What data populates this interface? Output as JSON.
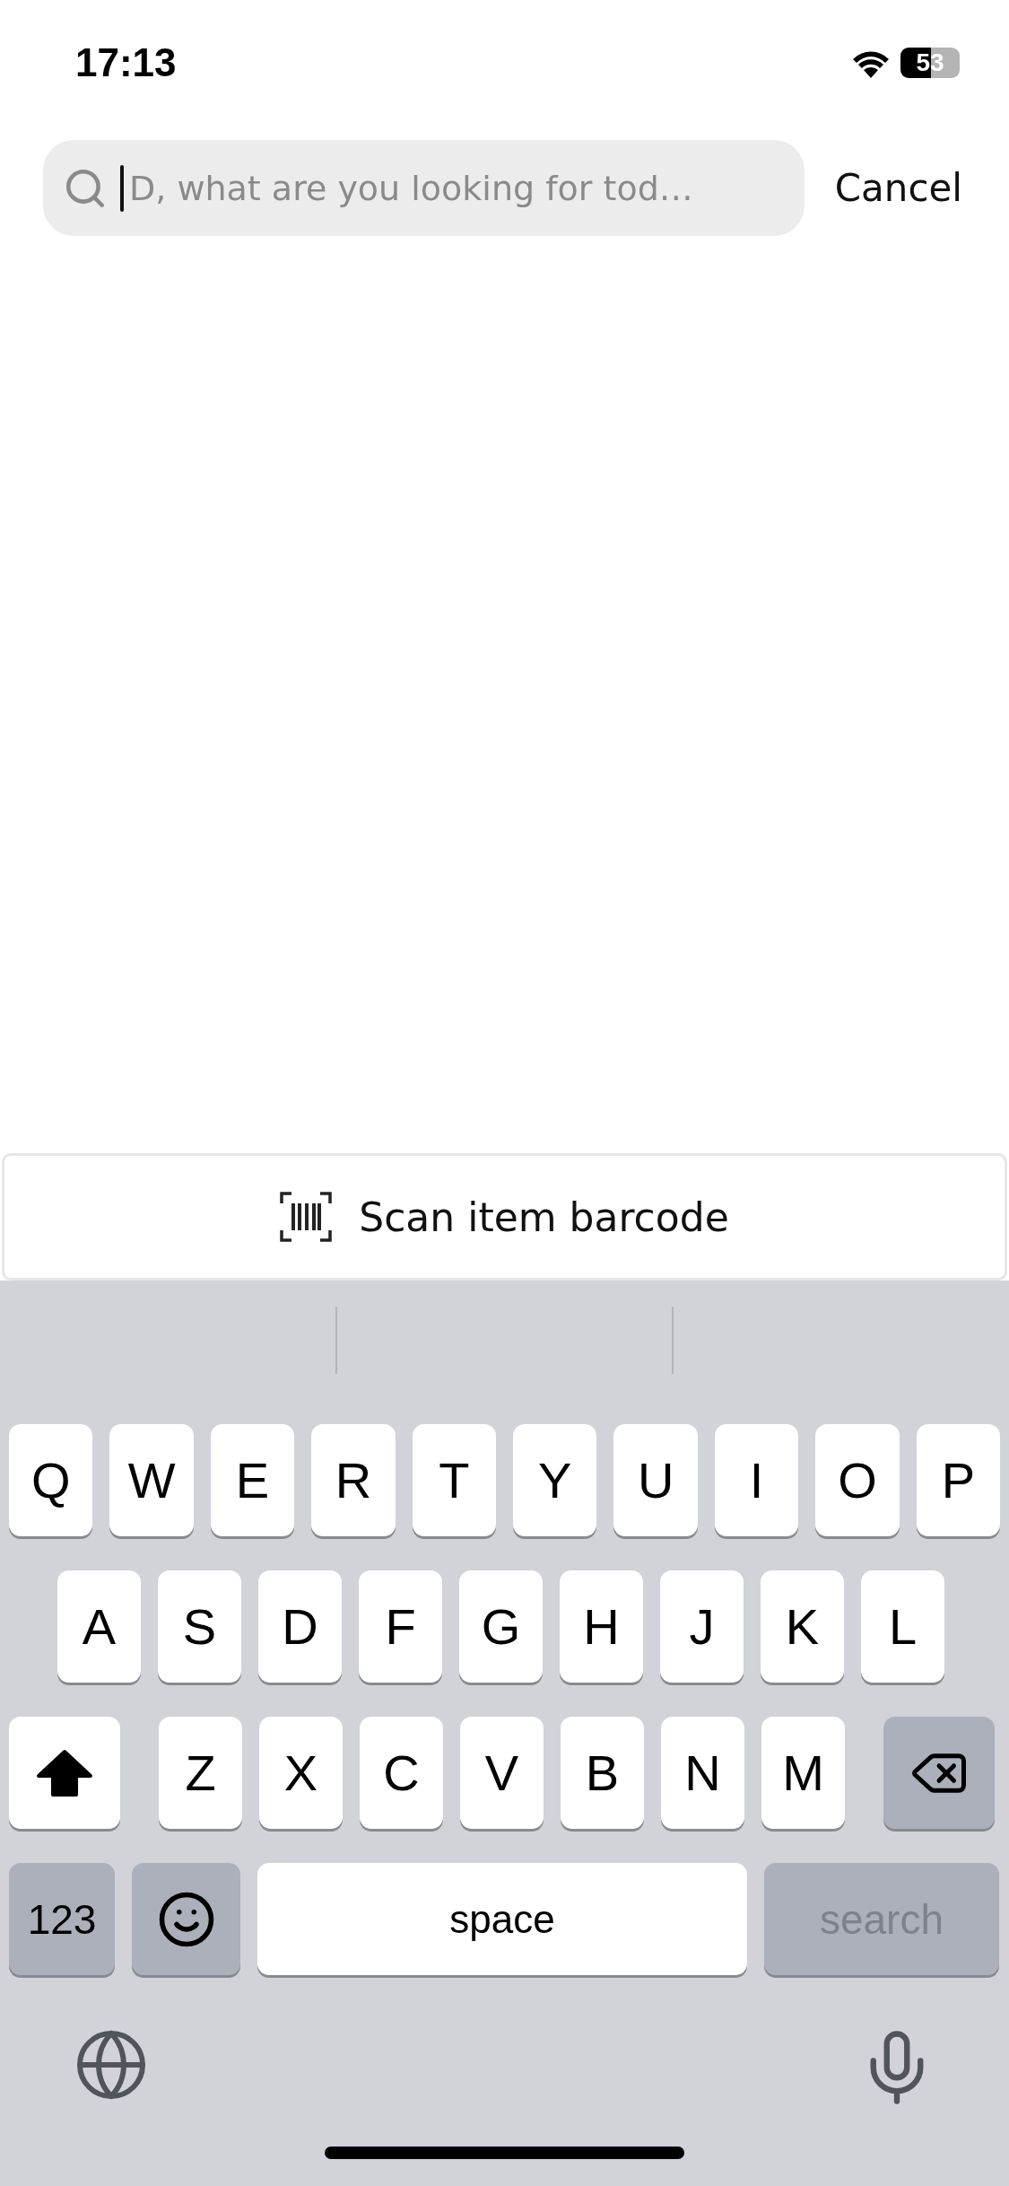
{
  "status_bar": {
    "time": "17:13",
    "battery": "53"
  },
  "search": {
    "placeholder": "D, what are you looking for tod…",
    "focused": true
  },
  "cancel": "Cancel",
  "scan_button": {
    "label": "Scan item barcode"
  },
  "keyboard": {
    "rows": [
      [
        {
          "kind": "letter",
          "label": "Q"
        },
        {
          "kind": "letter",
          "label": "W"
        },
        {
          "kind": "letter",
          "label": "E"
        },
        {
          "kind": "letter",
          "label": "R"
        },
        {
          "kind": "letter",
          "label": "T"
        },
        {
          "kind": "letter",
          "label": "Y"
        },
        {
          "kind": "letter",
          "label": "U"
        },
        {
          "kind": "letter",
          "label": "I"
        },
        {
          "kind": "letter",
          "label": "O"
        },
        {
          "kind": "letter",
          "label": "P"
        }
      ],
      [
        {
          "kind": "letter",
          "label": "A"
        },
        {
          "kind": "letter",
          "label": "S"
        },
        {
          "kind": "letter",
          "label": "D"
        },
        {
          "kind": "letter",
          "label": "F"
        },
        {
          "kind": "letter",
          "label": "G"
        },
        {
          "kind": "letter",
          "label": "H"
        },
        {
          "kind": "letter",
          "label": "J"
        },
        {
          "kind": "letter",
          "label": "K"
        },
        {
          "kind": "letter",
          "label": "L"
        }
      ],
      [
        {
          "kind": "shift",
          "on": true
        },
        {
          "kind": "letter",
          "label": "Z"
        },
        {
          "kind": "letter",
          "label": "X"
        },
        {
          "kind": "letter",
          "label": "C"
        },
        {
          "kind": "letter",
          "label": "V"
        },
        {
          "kind": "letter",
          "label": "B"
        },
        {
          "kind": "letter",
          "label": "N"
        },
        {
          "kind": "letter",
          "label": "M"
        },
        {
          "kind": "delete"
        }
      ]
    ],
    "function_row": [
      {
        "kind": "mode",
        "label": "123"
      },
      {
        "kind": "emoji"
      },
      {
        "kind": "space",
        "label": "space"
      },
      {
        "kind": "action",
        "label": "search",
        "disabled": true
      }
    ]
  }
}
